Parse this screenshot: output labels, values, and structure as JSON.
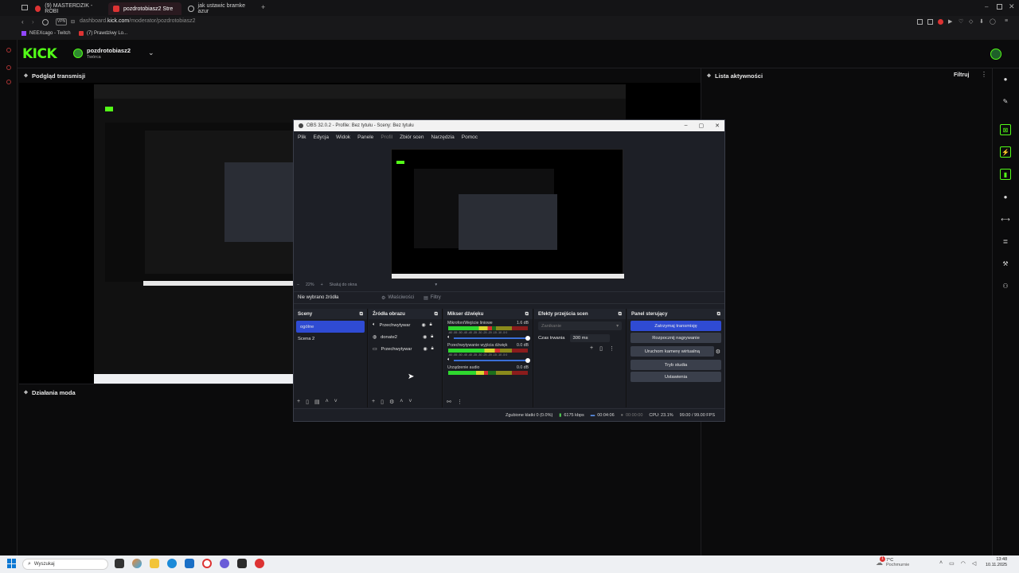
{
  "browser": {
    "tabs": [
      {
        "label": "(9) MASTERDZIK - ROBI",
        "active": false
      },
      {
        "label": "pozdrotobiasz2 Stre",
        "active": true
      },
      {
        "label": "jak ustawic bramke azur",
        "active": false
      }
    ],
    "url_domain": "dashboard.",
    "url_host": "kick.com",
    "url_path": "/moderator/pozdrotobiasz2",
    "bookmarks": [
      "NEEXcago - Twitch",
      "(7) Prawdziwy Lo..."
    ]
  },
  "kick": {
    "logo": "KICK",
    "channel_name": "pozdrotobiasz2",
    "channel_role": "Twórca",
    "brand_color": "#53fc18"
  },
  "panels": {
    "preview_title": "Podgląd transmisji",
    "activity_title": "Lista aktywności",
    "activity_filter": "Filtruj",
    "mod_actions_title": "Działania moda"
  },
  "obs": {
    "title": "OBS 32.0.2 - Profile: Bez tytułu - Sceny: Bez tytułu",
    "menu": [
      "Plik",
      "Edycja",
      "Widok",
      "Panele",
      "Profil",
      "Zbiór scen",
      "Narzędzia",
      "Pomoc"
    ],
    "zoom": "22%",
    "scale_label": "Skaluj do okna",
    "no_source": "Nie wybrano źródła",
    "properties": "Właściwości",
    "filters": "Filtry",
    "scenes_title": "Sceny",
    "scenes": [
      "ogólne",
      "Scena 2"
    ],
    "sources_title": "Źródła obrazu",
    "sources": [
      "Przechwytywar",
      "donate2",
      "Przechwytywar"
    ],
    "mixer_title": "Mikser dźwięku",
    "mixer": [
      {
        "name": "Mikrofon/Wejście liniowe",
        "db": "1.6 dB",
        "level": 0.55
      },
      {
        "name": "Przechwytywanie wyjścia dźwięk",
        "db": "0.0 dB",
        "level": 0.65
      },
      {
        "name": "Urządzenie audio",
        "db": "0.0 dB",
        "level": 0.5
      }
    ],
    "meter_scale": "-60 -55 -50 -45 -40 -35 -30 -25 -20 -15 -10 -5 0",
    "transitions_title": "Efekty przejścia scen",
    "transition_value": "Zanikanie",
    "duration_label": "Czas trwania",
    "duration_value": "300 ms",
    "controls_title": "Panel sterujący",
    "controls": [
      "Zatrzymaj transmisję",
      "Rozpocznij nagrywanie",
      "Uruchom kamerę wirtualną",
      "Tryb studia",
      "Ustawienia"
    ],
    "status": {
      "dropped": "Zgubione klatki 0 (0.0%)",
      "bitrate": "6175 kbps",
      "stream_time": "00:04:06",
      "rec_time": "00:00:00",
      "cpu": "CPU: 23.1%",
      "fps": "99.00 / 99.00 FPS"
    }
  },
  "taskbar": {
    "search_placeholder": "Wyszukaj",
    "weather_temp": "7°C",
    "weather_desc": "Pochmurnie",
    "weather_badge": "1",
    "time": "13:48",
    "date": "10.11.2025"
  }
}
